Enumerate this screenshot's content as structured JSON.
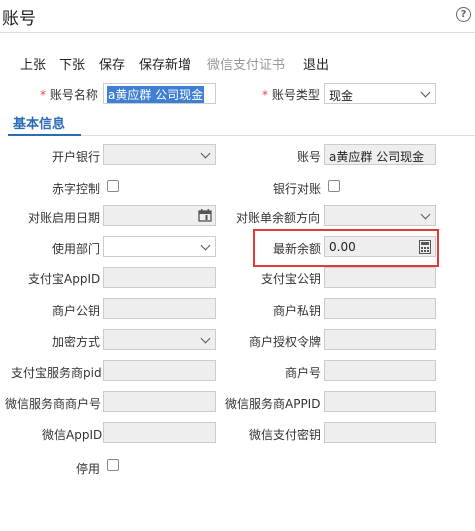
{
  "window": {
    "title": "账号",
    "help": "?"
  },
  "toolbar": {
    "items": [
      "上张",
      "下张",
      "保存",
      "保存新增",
      "微信支付证书",
      "退出"
    ]
  },
  "header": {
    "required_mark": "*",
    "account_name_label": "账号名称",
    "account_name_value": "a黄应群 公司现金",
    "account_type_label": "账号类型",
    "account_type_value": "现金"
  },
  "tabs": {
    "basic_info": "基本信息"
  },
  "form": {
    "bank_label": "开户银行",
    "account_label": "账号",
    "account_value": "a黄应群 公司现金",
    "red_control_label": "赤字控制",
    "bank_reconcile_label": "银行对账",
    "reconcile_start_label": "对账启用日期",
    "reconcile_balance_dir_label": "对账单余额方向",
    "dept_label": "使用部门",
    "latest_balance_label": "最新余额",
    "latest_balance_value": "0.00",
    "alipay_appid_label": "支付宝AppID",
    "alipay_pubkey_label": "支付宝公钥",
    "merchant_pubkey_label": "商户公钥",
    "merchant_privkey_label": "商户私钥",
    "encrypt_label": "加密方式",
    "merchant_auth_token_label": "商户授权令牌",
    "alipay_sp_pid_label": "支付宝服务商pid",
    "merchant_no_label": "商户号",
    "wechat_sp_merchant_label": "微信服务商商户号",
    "wechat_sp_appid_label": "微信服务商APPID",
    "wechat_appid_label": "微信AppID",
    "wechat_pay_key_label": "微信支付密钥",
    "disabled_label": "停用"
  }
}
